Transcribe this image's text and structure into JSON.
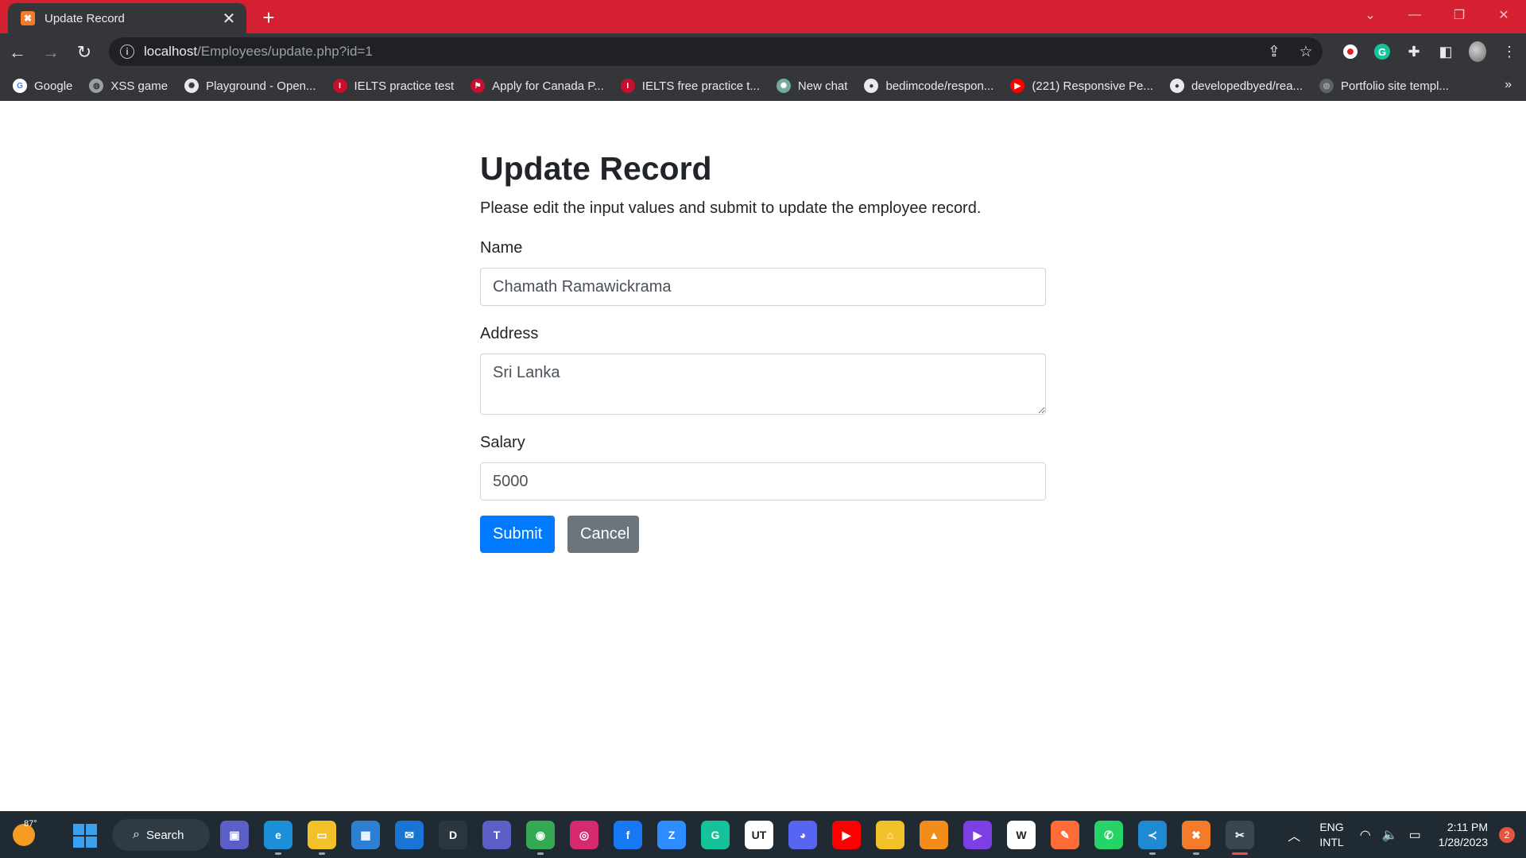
{
  "browser": {
    "tab": {
      "title": "Update Record",
      "close_glyph": "✕",
      "favicon": "xampp-icon"
    },
    "new_tab_glyph": "+",
    "window_controls": {
      "dropdown": "⌄",
      "minimize": "—",
      "restore": "❐",
      "close": "✕"
    },
    "url": {
      "host": "localhost",
      "path": "/Employees/update.php?id=1"
    },
    "bookmarks": [
      {
        "label": "Google",
        "icon": "google-icon",
        "color": "#ffffff",
        "glyph": "G",
        "text_color": "#4285f4"
      },
      {
        "label": "XSS game",
        "icon": "globe-icon",
        "color": "#9aa0a6",
        "glyph": "◍",
        "text_color": "#35363a"
      },
      {
        "label": "Playground - Open...",
        "icon": "openai-icon",
        "color": "#e8eaed",
        "glyph": "✺",
        "text_color": "#35363a"
      },
      {
        "label": "IELTS practice test",
        "icon": "ielts-icon",
        "color": "#c8102e",
        "glyph": "I",
        "text_color": "#ffffff"
      },
      {
        "label": "Apply for Canada P...",
        "icon": "canada-icon",
        "color": "#c8102e",
        "glyph": "⚑",
        "text_color": "#ffffff"
      },
      {
        "label": "IELTS free practice t...",
        "icon": "ielts-icon",
        "color": "#c8102e",
        "glyph": "I",
        "text_color": "#ffffff"
      },
      {
        "label": "New chat",
        "icon": "chatgpt-icon",
        "color": "#74aa9c",
        "glyph": "✺",
        "text_color": "#ffffff"
      },
      {
        "label": "bedimcode/respon...",
        "icon": "github-icon",
        "color": "#e8eaed",
        "glyph": "●",
        "text_color": "#35363a"
      },
      {
        "label": "(221) Responsive Pe...",
        "icon": "youtube-icon",
        "color": "#ff0000",
        "glyph": "▶",
        "text_color": "#ffffff"
      },
      {
        "label": "developedbyed/rea...",
        "icon": "github-icon",
        "color": "#e8eaed",
        "glyph": "●",
        "text_color": "#35363a"
      },
      {
        "label": "Portfolio site templ...",
        "icon": "globe-icon",
        "color": "#5f6368",
        "glyph": "◍",
        "text_color": "#9aa0a6"
      }
    ],
    "bookmarks_more": "»"
  },
  "page": {
    "title": "Update Record",
    "intro": "Please edit the input values and submit to update the employee record.",
    "form": {
      "name_label": "Name",
      "name_value": "Chamath Ramawickrama",
      "address_label": "Address",
      "address_value": "Sri Lanka",
      "salary_label": "Salary",
      "salary_value": "5000",
      "submit_label": "Submit",
      "cancel_label": "Cancel"
    }
  },
  "taskbar": {
    "weather_temp": "87°",
    "search_label": "Search",
    "apps": [
      {
        "icon": "meet-icon",
        "color": "#5b5fc7",
        "glyph": "▣",
        "active": false
      },
      {
        "icon": "edge-icon",
        "color": "#1c8fd8",
        "glyph": "e",
        "active": true
      },
      {
        "icon": "file-explorer-icon",
        "color": "#f2c029",
        "glyph": "▭",
        "active": true
      },
      {
        "icon": "store-icon",
        "color": "#2d7fd3",
        "glyph": "▦",
        "active": false
      },
      {
        "icon": "mail-icon",
        "color": "#1a74d4",
        "glyph": "✉",
        "active": false
      },
      {
        "icon": "dell-icon",
        "color": "#2a3640",
        "glyph": "D",
        "active": false
      },
      {
        "icon": "teams-icon",
        "color": "#5b5fc7",
        "glyph": "T",
        "active": false
      },
      {
        "icon": "chrome-icon",
        "color": "#34a853",
        "glyph": "◉",
        "active": true
      },
      {
        "icon": "instagram-icon",
        "color": "#d6296f",
        "glyph": "◎",
        "active": false
      },
      {
        "icon": "facebook-icon",
        "color": "#1877f2",
        "glyph": "f",
        "active": false
      },
      {
        "icon": "zoom-icon",
        "color": "#2d8cff",
        "glyph": "Z",
        "active": false
      },
      {
        "icon": "grammarly-icon",
        "color": "#15c39a",
        "glyph": "G",
        "active": false
      },
      {
        "icon": "ut-icon",
        "color": "#ffffff",
        "glyph": "UT",
        "active": false
      },
      {
        "icon": "discord-icon",
        "color": "#5865f2",
        "glyph": "◕",
        "active": false
      },
      {
        "icon": "youtube-icon",
        "color": "#ff0000",
        "glyph": "▶",
        "active": false
      },
      {
        "icon": "vpn-icon",
        "color": "#f2c029",
        "glyph": "⌂",
        "active": false
      },
      {
        "icon": "vlc-icon",
        "color": "#f28c1b",
        "glyph": "▲",
        "active": false
      },
      {
        "icon": "visual-studio-icon",
        "color": "#7b3fe4",
        "glyph": "▶",
        "active": false
      },
      {
        "icon": "wikipedia-icon",
        "color": "#ffffff",
        "glyph": "W",
        "active": false
      },
      {
        "icon": "postman-icon",
        "color": "#ff6c37",
        "glyph": "✎",
        "active": false
      },
      {
        "icon": "whatsapp-icon",
        "color": "#25d366",
        "glyph": "✆",
        "active": false
      },
      {
        "icon": "vscode-icon",
        "color": "#1f8ad2",
        "glyph": "≺",
        "active": true
      },
      {
        "icon": "xampp-icon",
        "color": "#f47b2a",
        "glyph": "✖",
        "active": true
      },
      {
        "icon": "snipping-tool-icon",
        "color": "#e6553f",
        "glyph": "✂",
        "active": false,
        "focused": true
      }
    ],
    "tray": {
      "chevron": "︿",
      "lang_1": "ENG",
      "lang_2": "INTL",
      "wifi": "◠",
      "volume": "🔈",
      "battery": "▭",
      "time": "2:11 PM",
      "date": "1/28/2023",
      "notifications": "2"
    }
  }
}
